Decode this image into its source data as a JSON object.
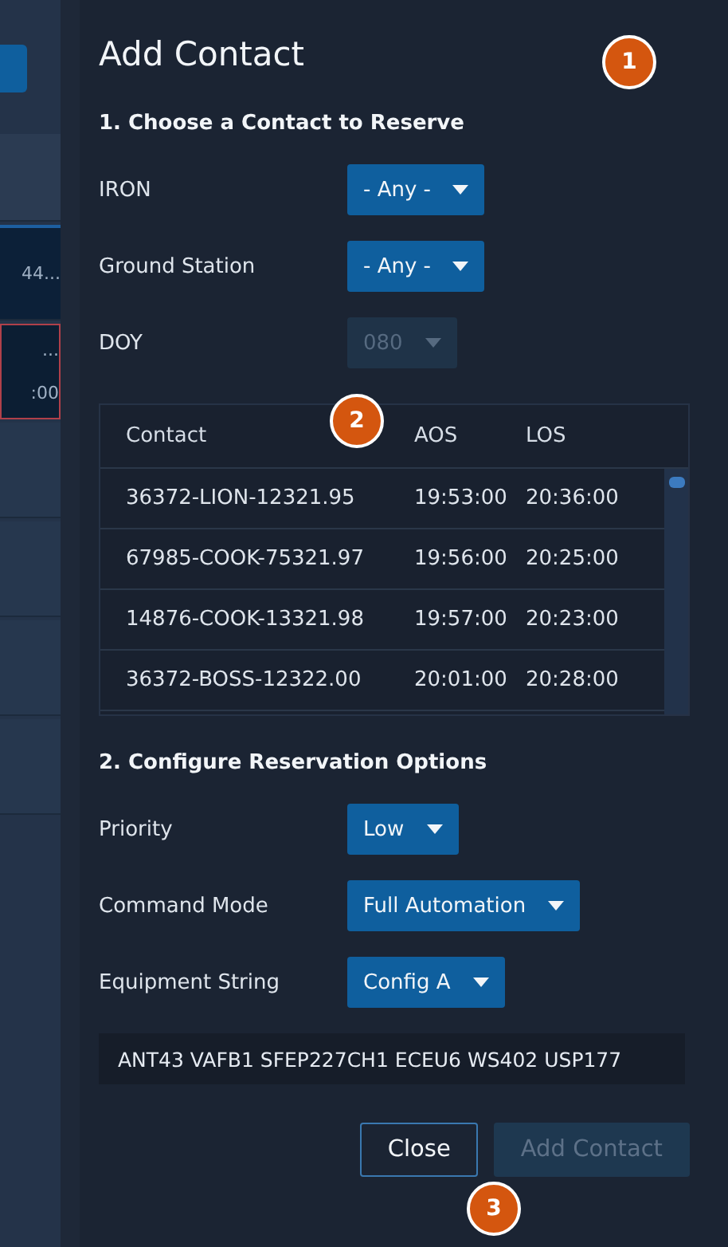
{
  "background": {
    "rows": [
      {
        "kind": "header"
      },
      {
        "kind": "row",
        "selected": true,
        "texts": [
          "44..."
        ]
      },
      {
        "kind": "row",
        "selected": false,
        "flagged": true,
        "texts": [
          "...",
          ":00"
        ]
      },
      {
        "kind": "row",
        "selected": false
      },
      {
        "kind": "row",
        "selected": false
      },
      {
        "kind": "row",
        "selected": false
      },
      {
        "kind": "row",
        "selected": false
      }
    ]
  },
  "dialog": {
    "title": "Add Contact",
    "section_1": {
      "heading": "1. Choose a Contact to Reserve",
      "fields": [
        {
          "label": "IRON",
          "value": "- Any -",
          "disabled": false
        },
        {
          "label": "Ground Station",
          "value": "- Any -",
          "disabled": false
        },
        {
          "label": "DOY",
          "value": "080",
          "disabled": true
        }
      ]
    },
    "table": {
      "columns": [
        "Contact",
        "AOS",
        "LOS"
      ],
      "rows": [
        {
          "cells": [
            "36372-LION-12321.95",
            "19:53:00",
            "20:36:00"
          ]
        },
        {
          "cells": [
            "67985-COOK-75321.97",
            "19:56:00",
            "20:25:00"
          ]
        },
        {
          "cells": [
            "14876-COOK-13321.98",
            "19:57:00",
            "20:23:00"
          ]
        },
        {
          "cells": [
            "36372-BOSS-12322.00",
            "20:01:00",
            "20:28:00"
          ]
        }
      ]
    },
    "section_2": {
      "heading": "2. Configure Reservation Options",
      "fields": [
        {
          "label": "Priority",
          "value": "Low",
          "disabled": false
        },
        {
          "label": "Command Mode",
          "value": "Full Automation",
          "disabled": false
        },
        {
          "label": "Equipment String",
          "value": "Config A",
          "disabled": false
        }
      ],
      "equipment": "ANT43 VAFB1 SFEP227CH1 ECEU6 WS402 USP177"
    },
    "buttons": [
      {
        "label": "Close",
        "kind": "secondary",
        "disabled": false
      },
      {
        "label": "Add Contact",
        "kind": "primary",
        "disabled": true
      }
    ]
  },
  "badges": [
    "1",
    "2",
    "3"
  ]
}
